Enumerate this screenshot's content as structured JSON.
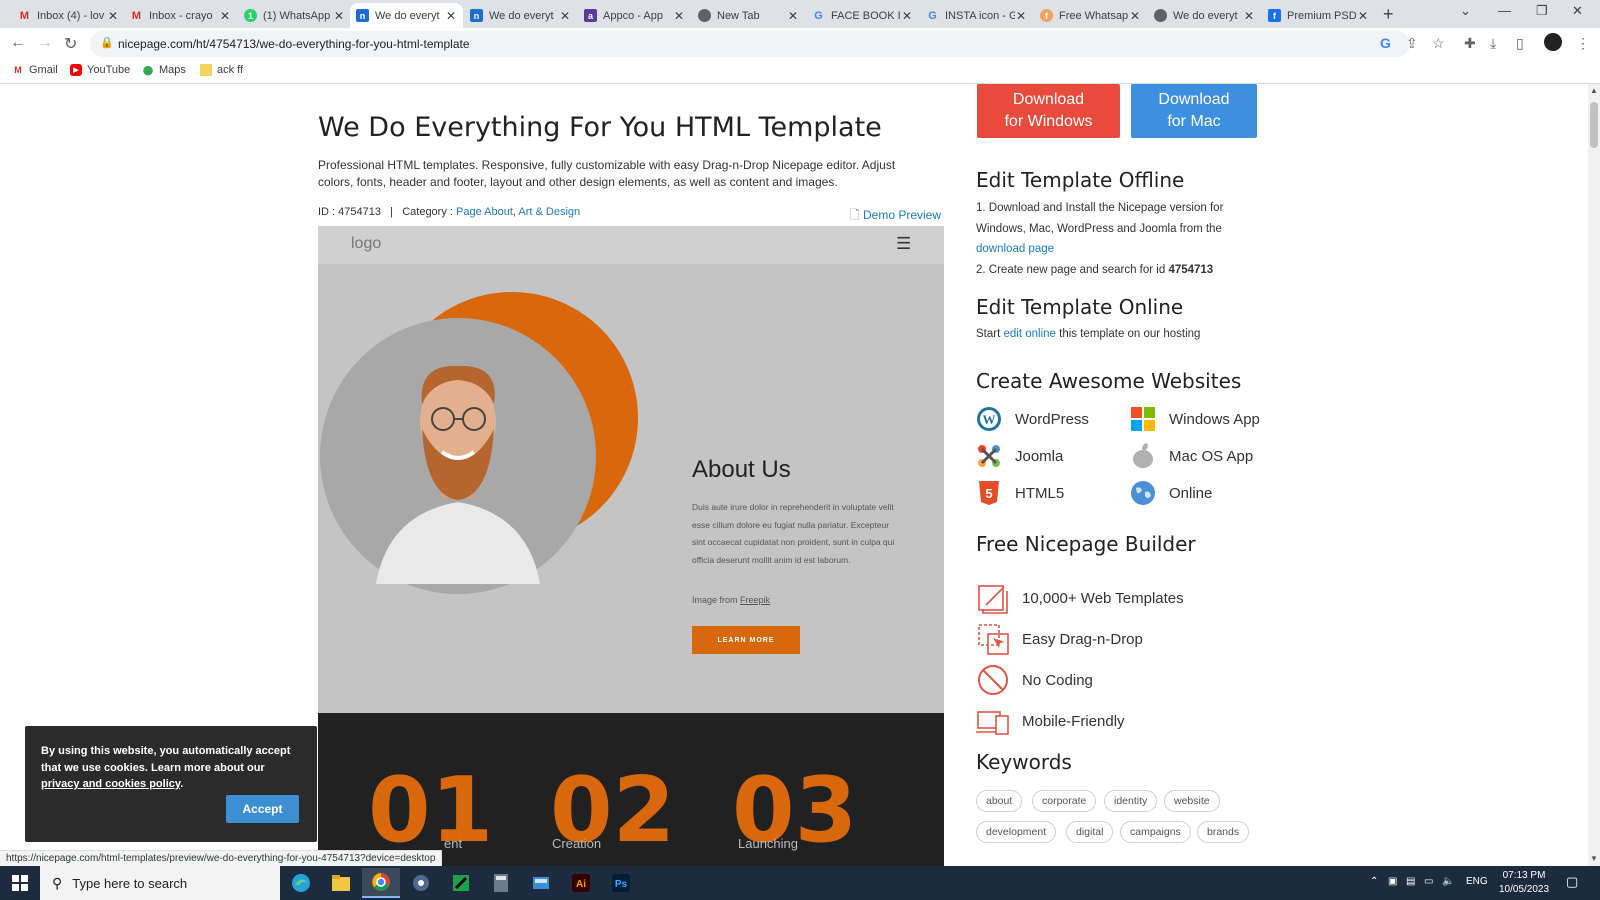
{
  "browser": {
    "tabs": [
      {
        "title": "Inbox (4) - lov",
        "icon": "gmail-icon",
        "color": "#d93025",
        "glyph": "M",
        "active": false
      },
      {
        "title": "Inbox - crayo",
        "icon": "gmail-icon",
        "color": "#d93025",
        "glyph": "M",
        "active": false
      },
      {
        "title": "(1) WhatsApp",
        "icon": "whatsapp-icon",
        "color": "#25d366",
        "glyph": "1",
        "active": false
      },
      {
        "title": "We do everyt",
        "icon": "nicepage-icon",
        "color": "#1b6ecf",
        "glyph": "n",
        "active": true
      },
      {
        "title": "We do everyt",
        "icon": "nicepage-icon",
        "color": "#1b6ecf",
        "glyph": "n",
        "active": false
      },
      {
        "title": "Appco - App",
        "icon": "appco-icon",
        "color": "#5b3a9b",
        "glyph": "a",
        "active": false
      },
      {
        "title": "New Tab",
        "icon": "chrome-icon",
        "color": "#5f6368",
        "glyph": "◉",
        "active": false
      },
      {
        "title": "FACE BOOK IC",
        "icon": "google-icon",
        "color": "#4285f4",
        "glyph": "G",
        "active": false
      },
      {
        "title": "INSTA icon - G",
        "icon": "google-icon",
        "color": "#4285f4",
        "glyph": "G",
        "active": false
      },
      {
        "title": "Free Whatsap",
        "icon": "freepik-icon",
        "color": "#f4a261",
        "glyph": "f",
        "active": false
      },
      {
        "title": "We do everyt",
        "icon": "globe-icon",
        "color": "#5f6368",
        "glyph": "◉",
        "active": false
      },
      {
        "title": "Premium PSD",
        "icon": "freepik-icon",
        "color": "#1273eb",
        "glyph": "f",
        "active": false
      }
    ],
    "url": "nicepage.com/ht/4754713/we-do-everything-for-you-html-template",
    "bookmarks": [
      {
        "label": "Gmail",
        "icon": "gmail-icon"
      },
      {
        "label": "YouTube",
        "icon": "youtube-icon"
      },
      {
        "label": "Maps",
        "icon": "maps-icon"
      },
      {
        "label": "ack ff",
        "icon": "folder-icon"
      }
    ],
    "status_url": "https://nicepage.com/html-templates/preview/we-do-everything-for-you-4754713?device=desktop"
  },
  "page": {
    "title": "We Do Everything For You HTML Template",
    "description": "Professional HTML templates. Responsive, fully customizable with easy Drag-n-Drop Nicepage editor. Adjust colors, fonts, header and footer, layout and other design elements, as well as content and images.",
    "id_label": "ID : 4754713",
    "separator": "|",
    "category_label": "Category :",
    "category_1": "Page About",
    "category_sep": ",",
    "category_2": "Art & Design",
    "demo_preview": "Demo Preview",
    "preview": {
      "logo": "logo",
      "hamburger": "☰",
      "about_title": "About Us",
      "about_text": "Duis aute irure dolor in reprehenderit in voluptate velit esse cillum dolore eu fugiat nulla pariatur. Excepteur sint occaecat cupidatat non proident, sunt in culpa qui officia deserunt mollit anim id est laborum.",
      "image_from": "Image from",
      "freepik": "Freepik",
      "learn_more": "LEARN MORE",
      "numbers": [
        "01",
        "02",
        "03"
      ],
      "number_labels": [
        "ent",
        "Creation",
        "Launching"
      ]
    }
  },
  "sidebar": {
    "download_windows_1": "Download",
    "download_windows_2": "for Windows",
    "download_mac_1": "Download",
    "download_mac_2": "for Mac",
    "offline_title": "Edit Template Offline",
    "offline_1": "1. Download and Install the Nicepage version for Windows, Mac, WordPress and Joomla from the",
    "offline_link": "download page",
    "offline_2a": "2. Create new page and search for id",
    "offline_2b": "4754713",
    "online_title": "Edit Template Online",
    "online_a": "Start",
    "online_link": "edit online",
    "online_b": "this template on our hosting",
    "create_title": "Create Awesome Websites",
    "platforms": [
      "WordPress",
      "Windows App",
      "Joomla",
      "Mac OS App",
      "HTML5",
      "Online"
    ],
    "builder_title": "Free Nicepage Builder",
    "features": [
      "10,000+ Web Templates",
      "Easy Drag-n-Drop",
      "No Coding",
      "Mobile-Friendly"
    ],
    "keywords_title": "Keywords",
    "keywords": [
      "about",
      "corporate",
      "identity",
      "website",
      "development",
      "digital",
      "campaigns",
      "brands"
    ]
  },
  "cookie": {
    "text_a": "By using this website, you automatically accept that we use cookies. Learn more about our",
    "link": "privacy and cookies policy",
    "text_b": ".",
    "accept": "Accept"
  },
  "taskbar": {
    "search_placeholder": "Type here to search",
    "lang": "ENG",
    "time": "07:13 PM",
    "date": "10/05/2023"
  },
  "colors": {
    "accent_orange": "#d9680d",
    "windows_button": "#e84a3c",
    "mac_button": "#3d8fe0",
    "link": "#1b7cc4"
  }
}
